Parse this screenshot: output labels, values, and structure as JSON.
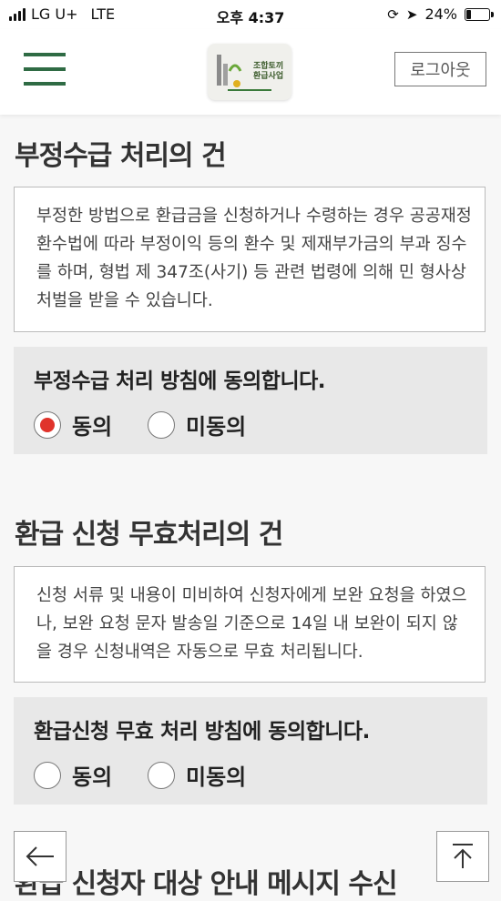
{
  "status_bar": {
    "carrier": "LG U+",
    "network": "LTE",
    "time": "오후 4:37",
    "battery": "24%",
    "battery_level": 0.24
  },
  "header": {
    "menu_icon": "hamburger-icon",
    "logo_line1": "조합토끼",
    "logo_line2": "환급사업",
    "logout_label": "로그아웃",
    "brand_color": "#2f6b44"
  },
  "sections": [
    {
      "title": "부정수급 처리의 건",
      "notice": "부정한 방법으로 환급금을 신청하거나 수령하는 경우 공공재정환수법에 따라 부정이익 등의 환수 및 제재부가금의 부과 징수를 하며, 형법 제 347조(사기) 등 관련 법령에 의해 민 형사상 처벌을 받을 수 있습니다.",
      "agree_title": "부정수급 처리 방침에 동의합니다.",
      "options": [
        "동의",
        "미동의"
      ],
      "selected": "동의"
    },
    {
      "title": "환급 신청 무효처리의 건",
      "notice": "신청 서류 및 내용이 미비하여 신청자에게 보완 요청을 하였으나, 보완 요청 문자 발송일 기준으로 14일 내 보완이 되지 않을 경우 신청내역은 자동으로 무효 처리됩니다.",
      "agree_title": "환급신청 무효 처리 방침에 동의합니다.",
      "options": [
        "동의",
        "미동의"
      ],
      "selected": ""
    },
    {
      "title": "환급 신청자 대상 안내 메시지 수신"
    }
  ],
  "floating": {
    "back_icon": "arrow-left-icon",
    "top_icon": "scroll-top-icon"
  },
  "colors": {
    "radio_selected": "#e0332b",
    "agree_bg": "#e8e8e8"
  }
}
